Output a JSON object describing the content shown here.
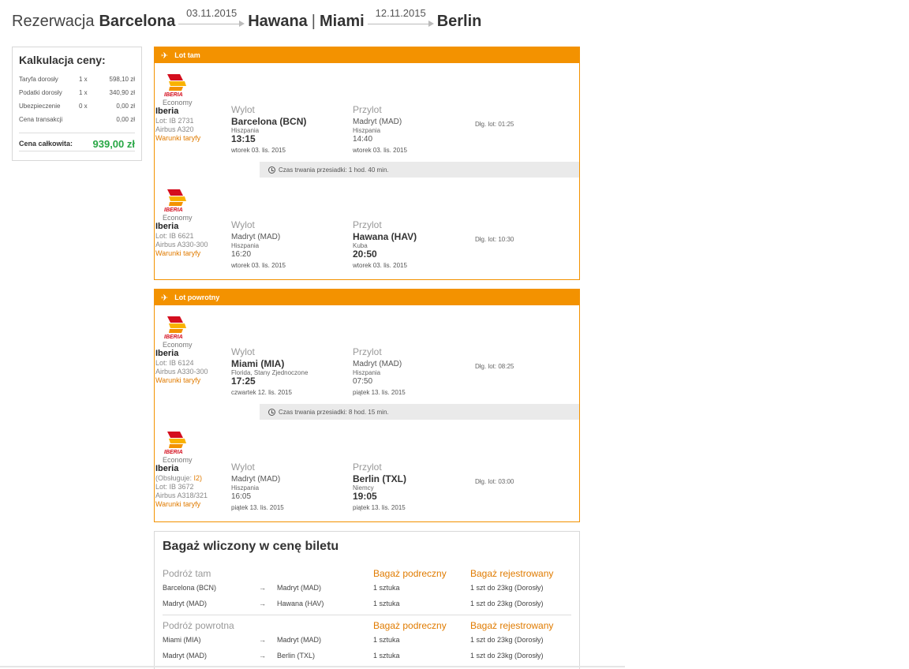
{
  "header": {
    "prefix": "Rezerwacja",
    "origin": "Barcelona",
    "date_out": "03.11.2015",
    "dest1": "Hawana",
    "separator": "|",
    "dest2": "Miami",
    "date_back": "12.11.2015",
    "final": "Berlin"
  },
  "price": {
    "title": "Kalkulacja ceny:",
    "rows": [
      {
        "label": "Taryfa dorosły",
        "qty": "1 x",
        "value": "598,10 zł"
      },
      {
        "label": "Podatki dorosły",
        "qty": "1 x",
        "value": "340,90 zł"
      },
      {
        "label": "Ubezpieczenie",
        "qty": "0 x",
        "value": "0,00 zł"
      },
      {
        "label": "Cena transakcji",
        "qty": "",
        "value": "0,00 zł"
      }
    ],
    "total_label": "Cena całkowita:",
    "total_value": "939,00 zł"
  },
  "outbound": {
    "title": "Lot tam",
    "legs": [
      {
        "class": "Economy",
        "airline": "Iberia",
        "operated": "",
        "operated_code": "",
        "flight": "Lot: IB 2731",
        "aircraft": "Airbus A320",
        "fare": "Warunki taryfy",
        "dep_label": "Wylot",
        "dep_place": "Barcelona (BCN)",
        "dep_country": "Hiszpania",
        "dep_time": "13:15",
        "dep_date": "wtorek 03. lis. 2015",
        "arr_label": "Przylot",
        "arr_place": "Madryt (MAD)",
        "arr_country": "Hiszpania",
        "arr_time": "14:40",
        "arr_date": "wtorek 03. lis. 2015",
        "duration": "Dłg. lot: 01:25",
        "layover": "Czas trwania przesiadki: 1 hod. 40 min."
      },
      {
        "class": "Economy",
        "airline": "Iberia",
        "operated": "",
        "operated_code": "",
        "flight": "Lot: IB 6621",
        "aircraft": "Airbus A330-300",
        "fare": "Warunki taryfy",
        "dep_label": "Wylot",
        "dep_place": "Madryt (MAD)",
        "dep_country": "Hiszpania",
        "dep_time": "16:20",
        "dep_date": "wtorek 03. lis. 2015",
        "arr_label": "Przylot",
        "arr_place": "Hawana (HAV)",
        "arr_country": "Kuba",
        "arr_time": "20:50",
        "arr_date": "wtorek 03. lis. 2015",
        "duration": "Dłg. lot: 10:30",
        "layover": ""
      }
    ]
  },
  "inbound": {
    "title": "Lot powrotny",
    "legs": [
      {
        "class": "Economy",
        "airline": "Iberia",
        "operated": "",
        "operated_code": "",
        "flight": "Lot: IB 6124",
        "aircraft": "Airbus A330-300",
        "fare": "Warunki taryfy",
        "dep_label": "Wylot",
        "dep_place": "Miami (MIA)",
        "dep_country": "Florida, Stany Zjednoczone",
        "dep_time": "17:25",
        "dep_date": "czwartek 12. lis. 2015",
        "arr_label": "Przylot",
        "arr_place": "Madryt (MAD)",
        "arr_country": "Hiszpania",
        "arr_time": "07:50",
        "arr_date": "piątek 13. lis. 2015",
        "duration": "Dłg. lot: 08:25",
        "layover": "Czas trwania przesiadki: 8 hod. 15 min."
      },
      {
        "class": "Economy",
        "airline": "Iberia",
        "operated": "(Obsługuje: ",
        "operated_code": "I2)",
        "flight": "Lot: IB 3672",
        "aircraft": "Airbus A318/321",
        "fare": "Warunki taryfy",
        "dep_label": "Wylot",
        "dep_place": "Madryt (MAD)",
        "dep_country": "Hiszpania",
        "dep_time": "16:05",
        "dep_date": "piątek 13. lis. 2015",
        "arr_label": "Przylot",
        "arr_place": "Berlin (TXL)",
        "arr_country": "Niemcy",
        "arr_time": "19:05",
        "arr_date": "piątek 13. lis. 2015",
        "duration": "Dłg. lot: 03:00",
        "layover": ""
      }
    ]
  },
  "baggage": {
    "title": "Bagaż wliczony w cenę biletu",
    "sections": [
      {
        "label": "Podróż tam",
        "carry_label": "Bagaż podreczny",
        "checked_label": "Bagaż rejestrowany",
        "rows": [
          {
            "from": "Barcelona (BCN)",
            "arrow": "→",
            "to": "Madryt (MAD)",
            "carry": "1 sztuka",
            "checked": "1 szt do 23kg (Dorosły)"
          },
          {
            "from": "Madryt (MAD)",
            "arrow": "→",
            "to": "Hawana (HAV)",
            "carry": "1 sztuka",
            "checked": "1 szt do 23kg (Dorosły)"
          }
        ]
      },
      {
        "label": "Podróż powrotna",
        "carry_label": "Bagaż podreczny",
        "checked_label": "Bagaż rejestrowany",
        "rows": [
          {
            "from": "Miami (MIA)",
            "arrow": "→",
            "to": "Madryt (MAD)",
            "carry": "1 sztuka",
            "checked": "1 szt do 23kg (Dorosły)"
          },
          {
            "from": "Madryt (MAD)",
            "arrow": "→",
            "to": "Berlin (TXL)",
            "carry": "1 sztuka",
            "checked": "1 szt do 23kg (Dorosły)"
          }
        ]
      }
    ]
  },
  "icons": {
    "plane": "plane-icon",
    "clock": "clock-icon",
    "logo": "iberia-logo"
  },
  "colors": {
    "accent": "#f39200",
    "link": "#e07b00",
    "total": "#28a745"
  }
}
